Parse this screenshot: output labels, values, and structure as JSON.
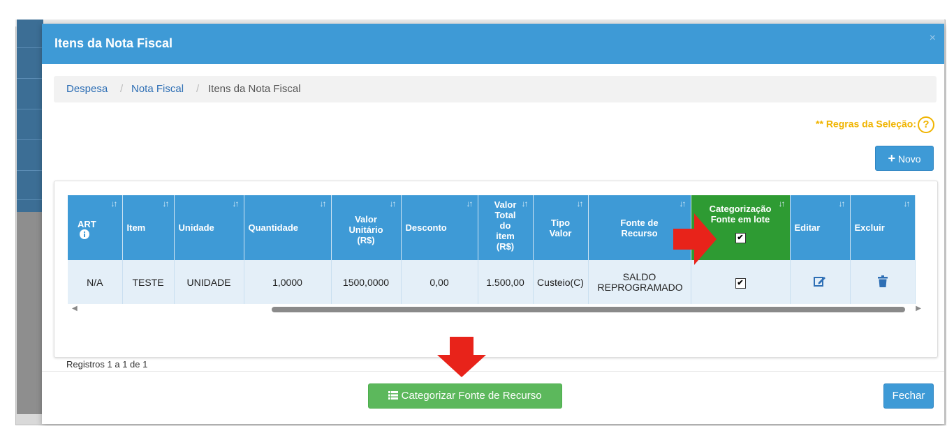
{
  "modal": {
    "title": "Itens da Nota Fiscal",
    "close_symbol": "×"
  },
  "breadcrumb": {
    "items": [
      "Despesa",
      "Nota Fiscal",
      "Itens da Nota Fiscal"
    ],
    "separator": "/"
  },
  "rules": {
    "label": "** Regras da Seleção:",
    "icon": "question-circle-icon",
    "icon_glyph": "?"
  },
  "buttons": {
    "novo_label": "Novo",
    "novo_icon": "+",
    "categorizar_label": "Categorizar Fonte de Recurso",
    "categorizar_icon": "list-icon",
    "fechar_label": "Fechar"
  },
  "table": {
    "columns": [
      {
        "key": "art",
        "label": "ART",
        "icon": "info-icon"
      },
      {
        "key": "item",
        "label": "Item"
      },
      {
        "key": "unidade",
        "label": "Unidade"
      },
      {
        "key": "quantidade",
        "label": "Quantidade"
      },
      {
        "key": "valor_unitario",
        "label": "Valor Unitário (R$)"
      },
      {
        "key": "desconto",
        "label": "Desconto"
      },
      {
        "key": "valor_total",
        "label": "Valor Total do item (R$)"
      },
      {
        "key": "tipo_valor",
        "label": "Tipo Valor"
      },
      {
        "key": "fonte_recurso",
        "label": "Fonte de Recurso"
      },
      {
        "key": "categorizacao",
        "label": "Categorização Fonte em lote",
        "header_checkbox_checked": true
      },
      {
        "key": "editar",
        "label": "Editar"
      },
      {
        "key": "excluir",
        "label": "Excluir"
      }
    ],
    "rows": [
      {
        "art": "N/A",
        "item": "TESTE",
        "unidade": "UNIDADE",
        "quantidade": "1,0000",
        "valor_unitario": "1500,0000",
        "desconto": "0,00",
        "valor_total": "1.500,00",
        "tipo_valor": "Custeio(C)",
        "fonte_recurso": "SALDO REPROGRAMADO",
        "categorizacao_checked": true
      }
    ],
    "records_text": "Registros 1 a 1 de 1"
  },
  "colors": {
    "header_blue": "#3e9ad6",
    "highlight_green": "#2e9b33",
    "button_green": "#5cb85c",
    "rules_yellow": "#f0b400",
    "arrow_red": "#e8231a"
  }
}
